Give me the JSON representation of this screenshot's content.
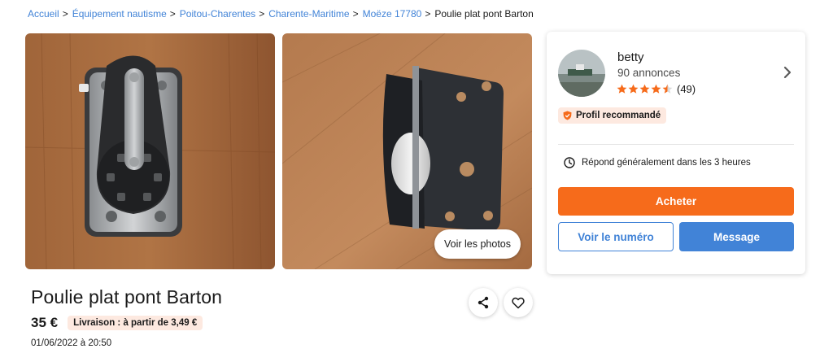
{
  "breadcrumb": {
    "items": [
      {
        "label": "Accueil"
      },
      {
        "label": "Équipement nautisme"
      },
      {
        "label": "Poitou-Charentes"
      },
      {
        "label": "Charente-Maritime"
      },
      {
        "label": "Moëze 17780"
      }
    ],
    "current": "Poulie plat pont Barton",
    "separator": ">"
  },
  "gallery": {
    "photo_1_icon": "pulley-block-photo",
    "photo_2_icon": "pulley-block-side-photo",
    "see_photos_label": "Voir les photos"
  },
  "ad": {
    "title": "Poulie plat pont Barton",
    "price": "35 €",
    "delivery": "Livraison : à partir de 3,49 €",
    "date": "01/06/2022 à 20:50"
  },
  "actions": {
    "share_icon": "share-icon",
    "favorite_icon": "heart-icon"
  },
  "seller": {
    "name": "betty",
    "ads_count": "90 annonces",
    "rating_stars": 4.5,
    "rating_count": "(49)",
    "badge": "Profil recommandé",
    "response_time": "Répond généralement dans les 3 heures",
    "buy_label": "Acheter",
    "phone_label": "Voir le numéro",
    "message_label": "Message"
  },
  "colors": {
    "link": "#4183d7",
    "accent_orange": "#f66b1b",
    "badge_bg": "#fde9e0",
    "primary_blue": "#4183d7"
  }
}
